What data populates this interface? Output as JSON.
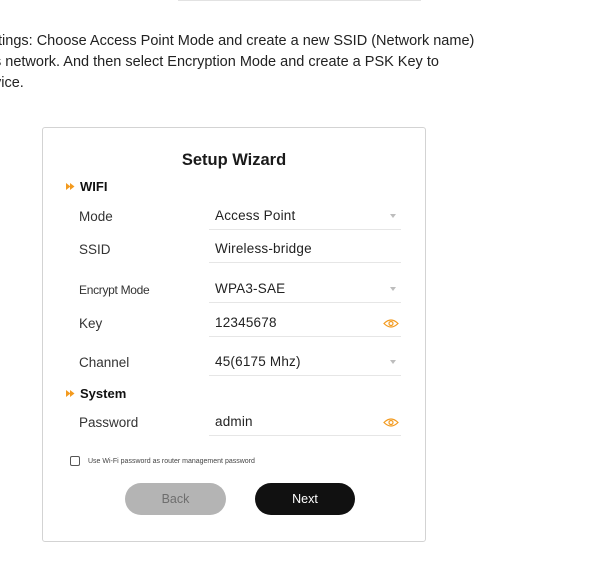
{
  "instructions": {
    "line1": "ttings: Choose Access Point Mode and create a new SSID (Network name)",
    "line2": "s network. And then select Encryption Mode and create a PSK Key to",
    "line3": "vice."
  },
  "wizard": {
    "title": "Setup Wizard",
    "wifi_section": "WIFI",
    "system_section": "System",
    "mode": {
      "label": "Mode",
      "value": "Access Point"
    },
    "ssid": {
      "label": "SSID",
      "value": "Wireless-bridge"
    },
    "encrypt_mode": {
      "label": "Encrypt Mode",
      "value": "WPA3-SAE"
    },
    "key": {
      "label": "Key",
      "value": "12345678"
    },
    "channel": {
      "label": "Channel",
      "value": "45(6175 Mhz)"
    },
    "password": {
      "label": "Password",
      "value": "admin"
    },
    "checkbox_label": "Use Wi-Fi password as router management password",
    "checkbox_checked": false,
    "back_label": "Back",
    "next_label": "Next"
  },
  "icons": {
    "section_marker": "double-chevron-right-icon",
    "show_password": "eye-icon",
    "dropdown": "caret-down-icon"
  },
  "colors": {
    "accent": "#f39a1e",
    "next_button": "#111111",
    "back_button": "#b4b4b4"
  }
}
